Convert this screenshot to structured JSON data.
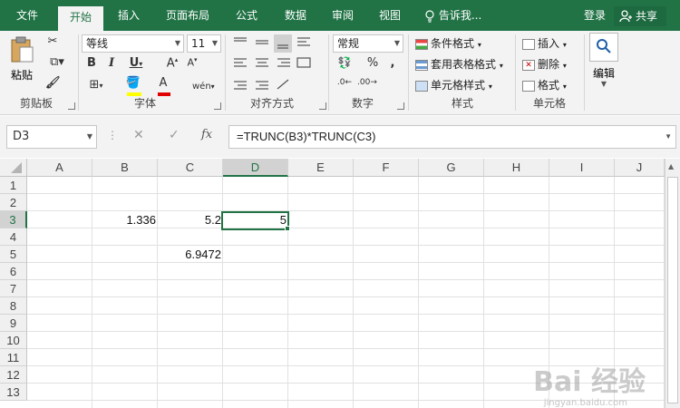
{
  "tabs": [
    {
      "label": "文件",
      "active": false
    },
    {
      "label": "开始",
      "active": true
    },
    {
      "label": "插入",
      "active": false
    },
    {
      "label": "页面布局",
      "active": false
    },
    {
      "label": "公式",
      "active": false
    },
    {
      "label": "数据",
      "active": false
    },
    {
      "label": "审阅",
      "active": false
    },
    {
      "label": "视图",
      "active": false
    }
  ],
  "tell_me": "告诉我...",
  "login": "登录",
  "share": "共享",
  "ribbon": {
    "clipboard": {
      "paste": "粘贴",
      "label": "剪贴板"
    },
    "font": {
      "name": "等线",
      "size": "11",
      "label": "字体",
      "phonetic": "wén"
    },
    "alignment": {
      "label": "对齐方式"
    },
    "number": {
      "format": "常规",
      "label": "数字"
    },
    "styles": {
      "conditional": "条件格式",
      "table": "套用表格格式",
      "cell": "单元格样式",
      "label": "样式"
    },
    "cells": {
      "insert": "插入",
      "delete": "删除",
      "format": "格式",
      "label": "单元格"
    },
    "editing": {
      "label": "编辑"
    }
  },
  "formula_bar": {
    "name_box": "D3",
    "formula": "=TRUNC(B3)*TRUNC(C3)"
  },
  "sheet": {
    "columns": [
      "A",
      "B",
      "C",
      "D",
      "E",
      "F",
      "G",
      "H",
      "I",
      "J"
    ],
    "rows": [
      "1",
      "2",
      "3",
      "4",
      "5",
      "6",
      "7",
      "8",
      "9",
      "10",
      "11",
      "12",
      "13"
    ],
    "selected_cell": "D3",
    "cells": {
      "B3": "1.336",
      "C3": "5.2",
      "D3": "5",
      "C5": "6.9472"
    }
  },
  "watermark": {
    "main": "Bai 经验",
    "sub": "jingyan.baidu.com"
  },
  "colors": {
    "accent": "#217346"
  }
}
